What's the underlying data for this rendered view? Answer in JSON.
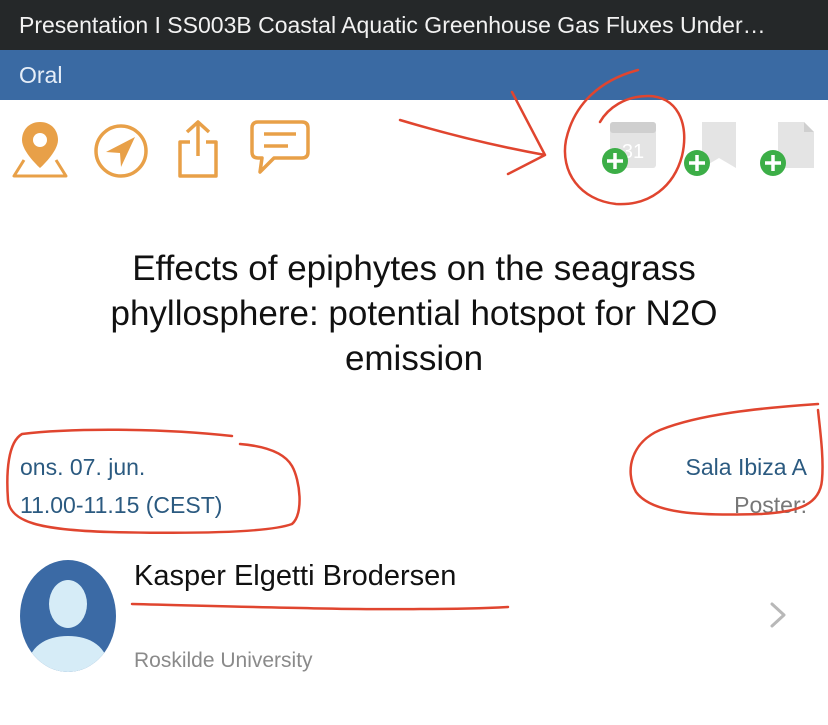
{
  "header": {
    "title": "Presentation I SS003B Coastal Aquatic Greenhouse Gas Fluxes Under…",
    "session_type": "Oral"
  },
  "toolbar": {
    "icons": [
      "map-pin-icon",
      "navigate-icon",
      "share-icon",
      "chat-icon",
      "add-to-calendar-icon",
      "add-bookmark-icon",
      "add-note-icon"
    ],
    "calendar_day": "31",
    "accent_color": "#e8a048",
    "add_color": "#3cae47"
  },
  "presentation": {
    "title": "Effects of epiphytes on the seagrass phyllosphere: potential hotspot for N2O emission",
    "date": "ons. 07. jun.",
    "time": "11.00-11.15 (CEST)",
    "room": "Sala Ibiza A",
    "poster_label": "Poster:"
  },
  "speaker": {
    "name": "Kasper Elgetti Brodersen",
    "affiliation": "Roskilde University"
  }
}
